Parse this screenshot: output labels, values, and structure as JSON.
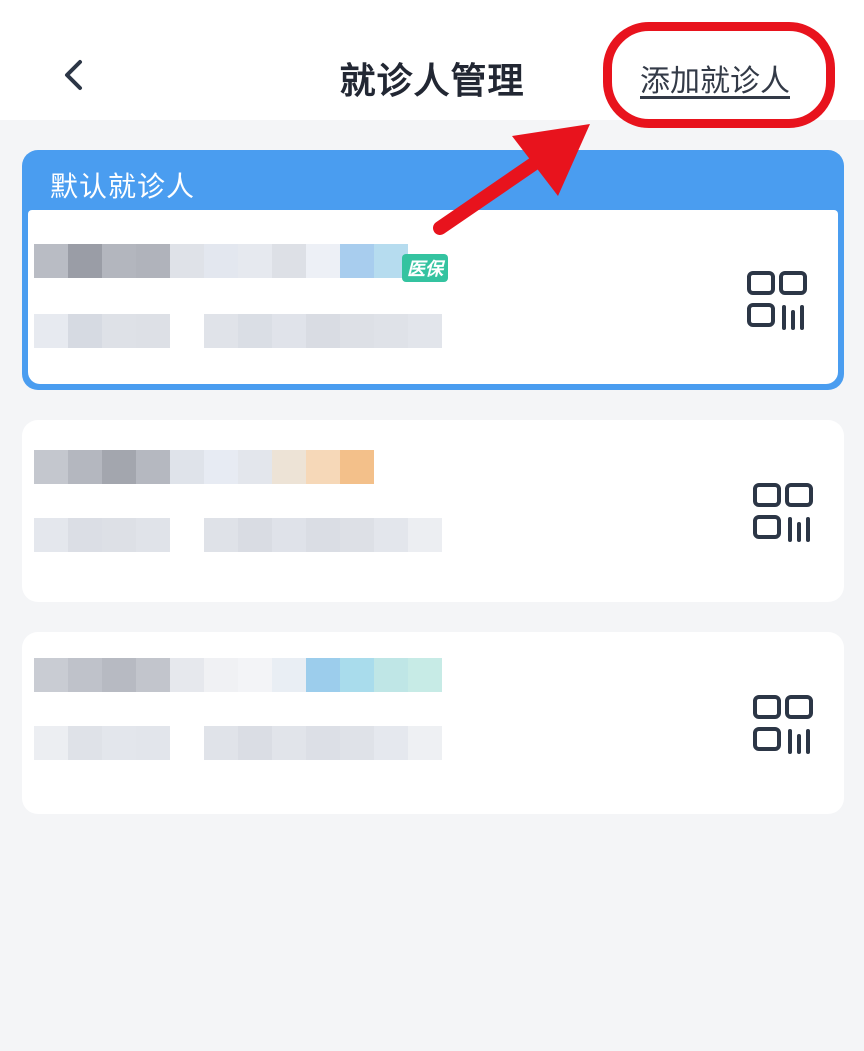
{
  "header": {
    "title": "就诊人管理",
    "add_link": "添加就诊人",
    "back_icon": "chevron-left-icon"
  },
  "default_section": {
    "label": "默认就诊人"
  },
  "patients": [
    {
      "badge": "医保",
      "badge_color": "#34c3a0",
      "qr_icon": "qr-code-icon"
    },
    {
      "qr_icon": "qr-code-icon"
    },
    {
      "qr_icon": "qr-code-icon"
    }
  ],
  "colors": {
    "accent": "#4a9df0",
    "annotation": "#e8131d",
    "background": "#f4f5f7",
    "icon": "#2c3646"
  }
}
